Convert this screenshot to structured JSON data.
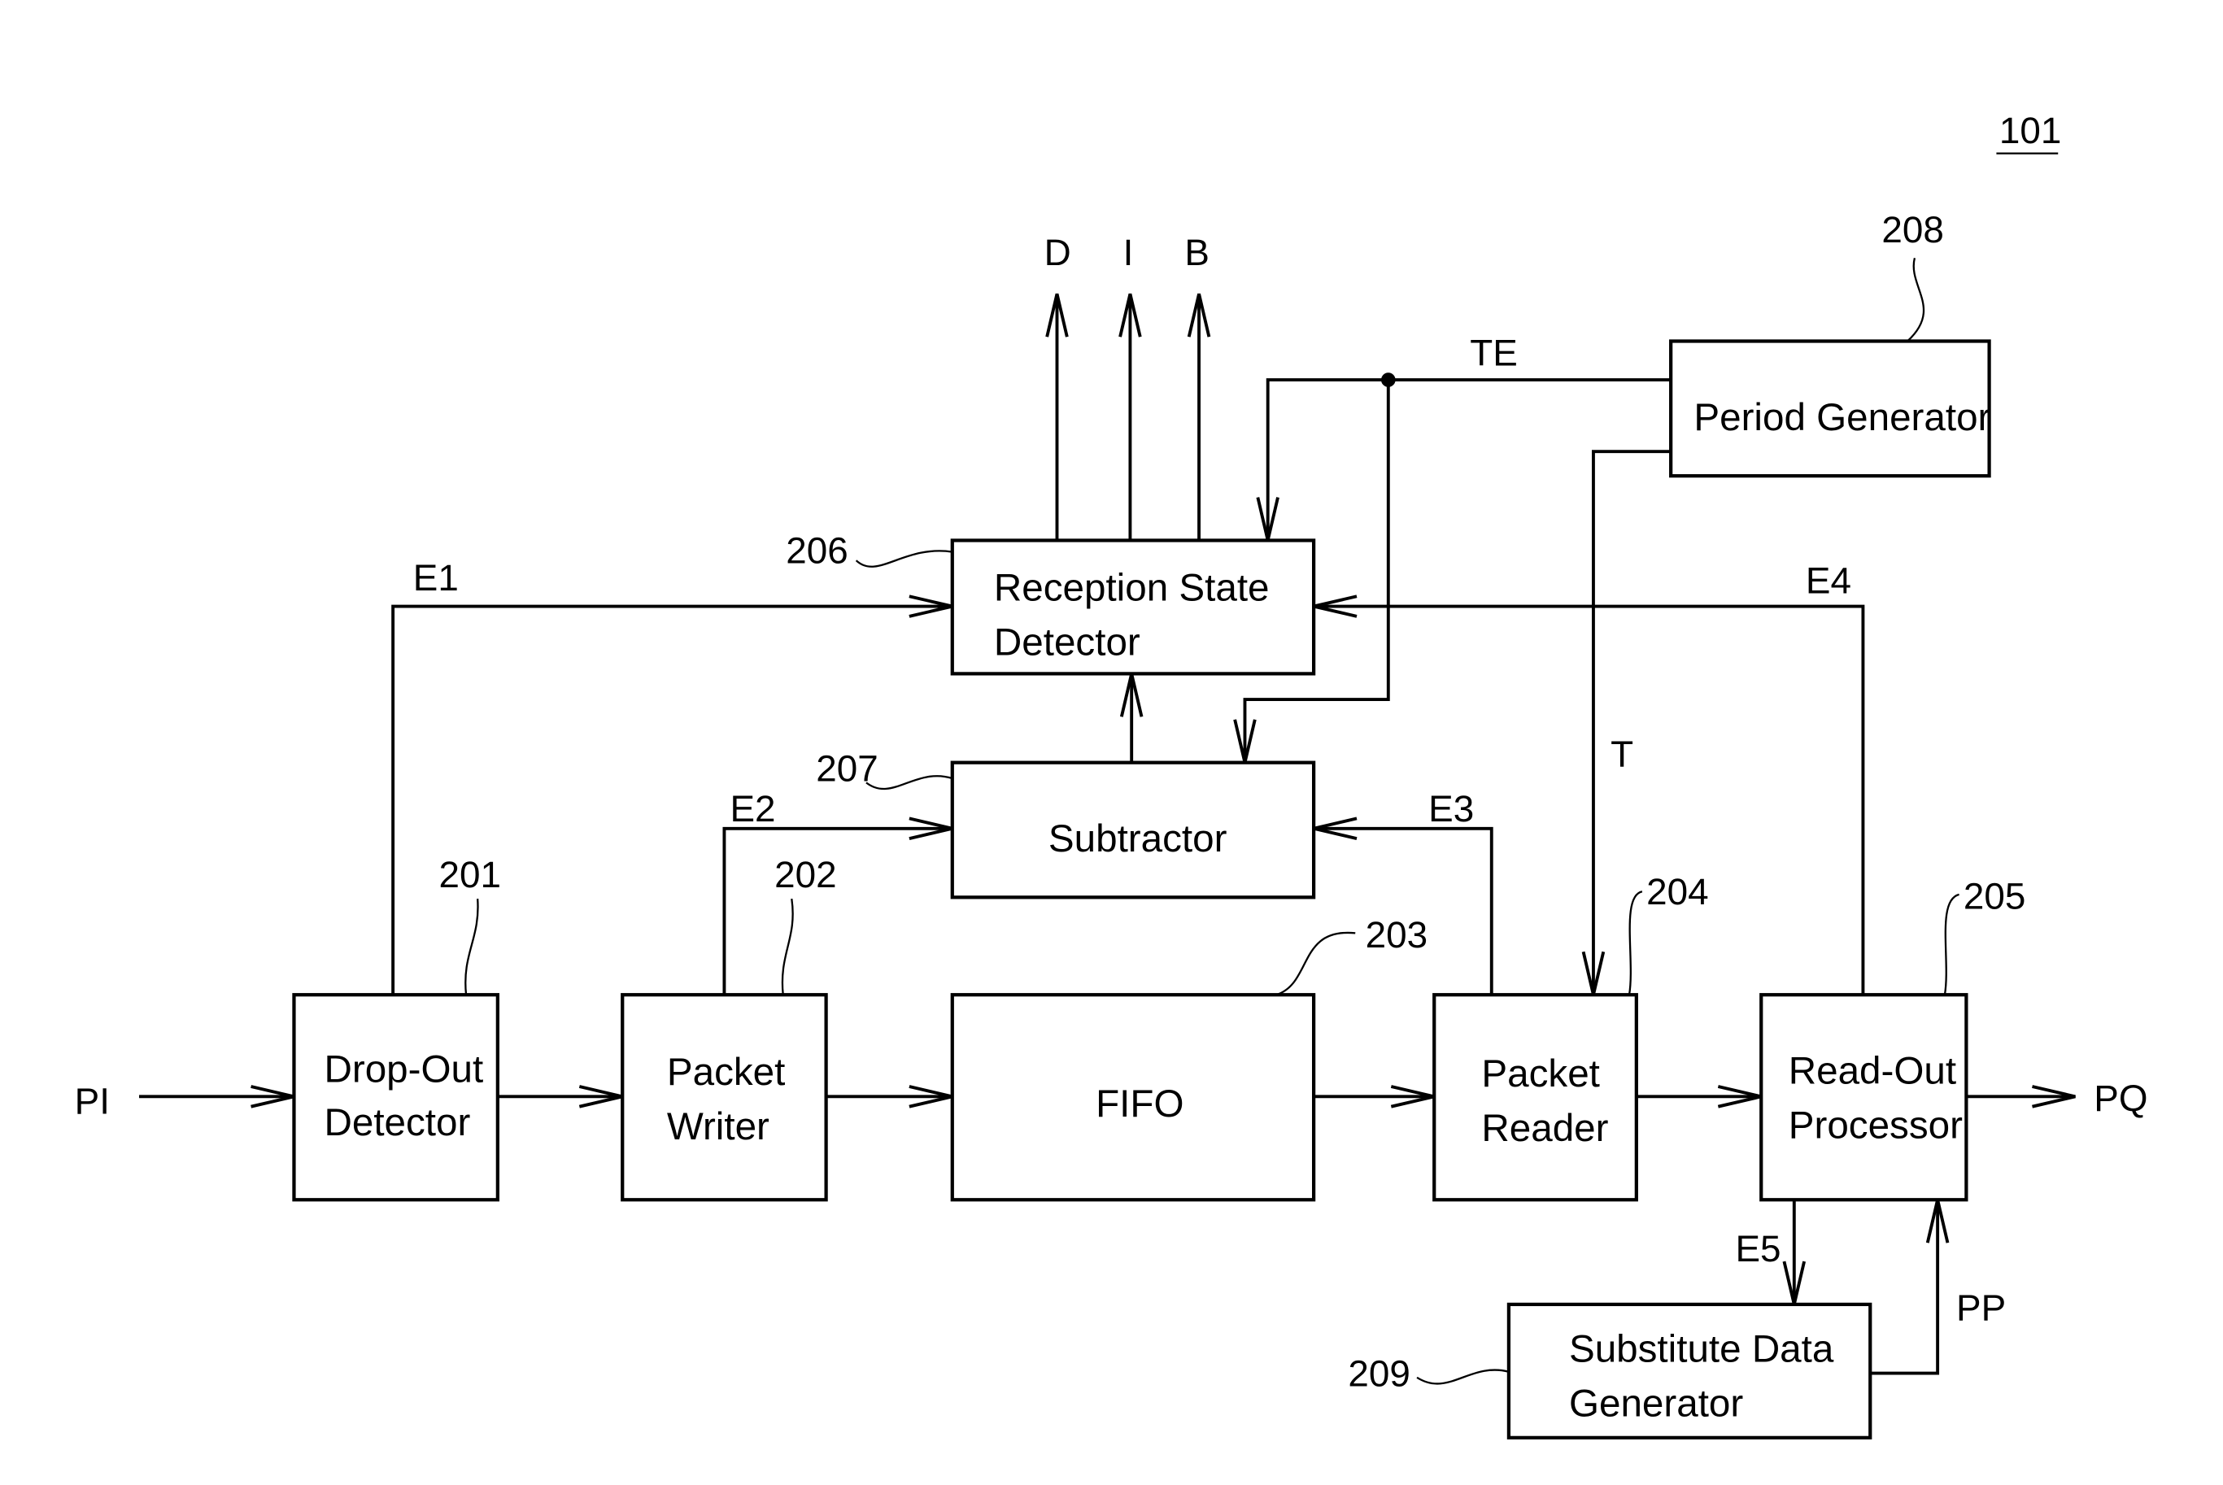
{
  "figure": {
    "reference_number": "101"
  },
  "blocks": {
    "drop_out_detector": {
      "ref": "201",
      "lines": [
        "Drop-Out",
        "Detector"
      ]
    },
    "packet_writer": {
      "ref": "202",
      "lines": [
        "Packet",
        "Writer"
      ]
    },
    "fifo": {
      "ref": "203",
      "lines": [
        "FIFO"
      ]
    },
    "packet_reader": {
      "ref": "204",
      "lines": [
        "Packet",
        "Reader"
      ]
    },
    "read_out_processor": {
      "ref": "205",
      "lines": [
        "Read-Out",
        "Processor"
      ]
    },
    "reception_state_detector": {
      "ref": "206",
      "lines": [
        "Reception State",
        "Detector"
      ]
    },
    "subtractor": {
      "ref": "207",
      "lines": [
        "Subtractor"
      ]
    },
    "period_generator": {
      "ref": "208",
      "lines": [
        "Period Generator"
      ]
    },
    "substitute_data_generator": {
      "ref": "209",
      "lines": [
        "Substitute Data",
        "Generator"
      ]
    }
  },
  "signals": {
    "input": "PI",
    "output": "PQ",
    "e1": "E1",
    "e2": "E2",
    "e3": "E3",
    "e4": "E4",
    "e5": "E5",
    "te": "TE",
    "t": "T",
    "pp": "PP",
    "out_d": "D",
    "out_i": "I",
    "out_b": "B"
  }
}
